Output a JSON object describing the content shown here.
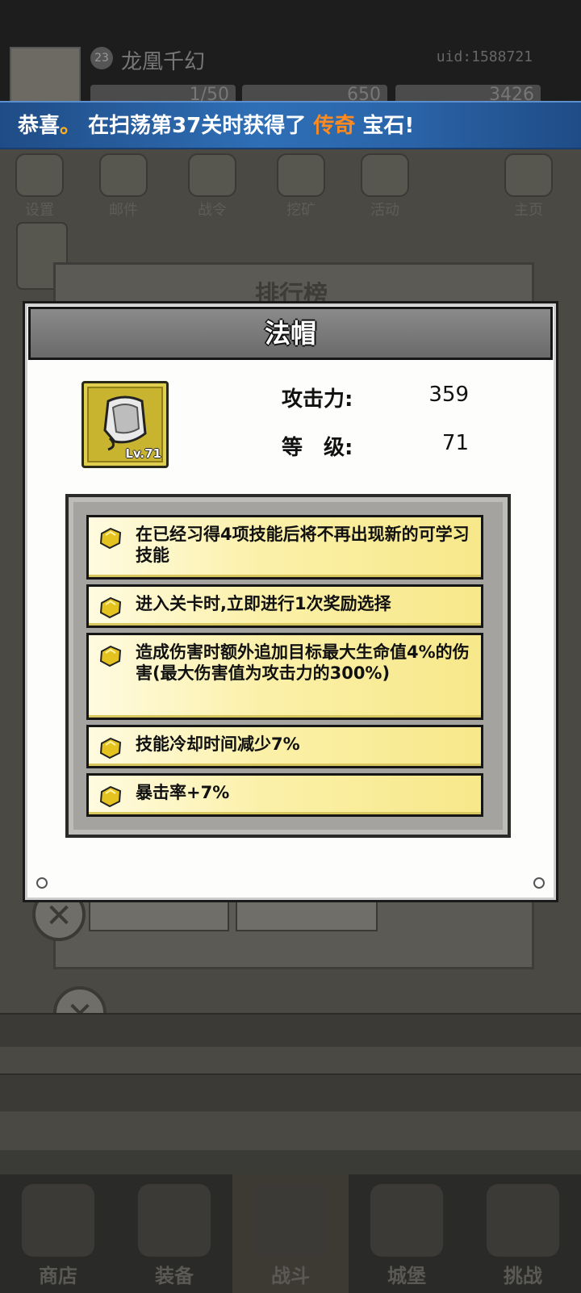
{
  "player": {
    "level": "23",
    "name": "龙凰千幻",
    "uid": "uid:1588721",
    "resources": [
      "1/50",
      "650",
      "3426"
    ]
  },
  "banner": {
    "prefix": "恭喜",
    "dot": "。",
    "middle": "在扫荡第37关时获得了",
    "highlight": "传奇",
    "suffix": "宝石!"
  },
  "top_icons": [
    "设置",
    "邮件",
    "战令",
    "挖矿",
    "活动",
    "主页"
  ],
  "bg_panel_title": "排行榜",
  "modal": {
    "title": "法帽",
    "item_level": "Lv.71",
    "attack_label": "攻击力:",
    "attack_value": "359",
    "level_label": "等　级:",
    "level_value": "71",
    "skills": [
      "在已经习得4项技能后将不再出现新的可学习技能",
      "进入关卡时,立即进行1次奖励选择",
      "造成伤害时额外追加目标最大生命值4%的伤害(最大伤害值为攻击力的300%)",
      "技能冷却时间减少7%",
      "暴击率+7%"
    ]
  },
  "bottom_nav": [
    "商店",
    "装备",
    "战斗",
    "城堡",
    "挑战"
  ]
}
